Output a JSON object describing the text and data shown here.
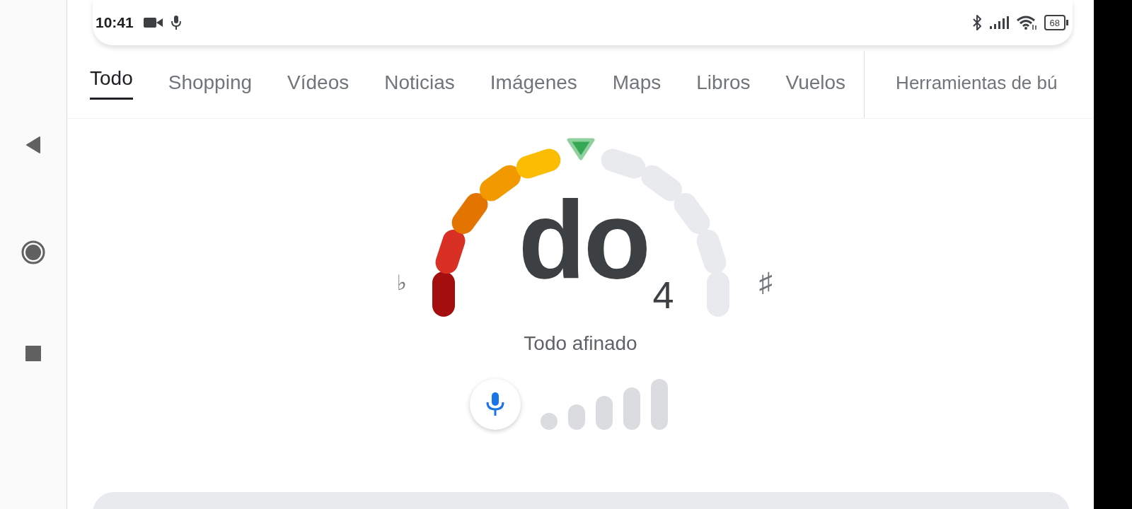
{
  "status_bar": {
    "time": "10:41",
    "battery": "68"
  },
  "nav_buttons": [
    {
      "kind": "back"
    },
    {
      "kind": "home"
    },
    {
      "kind": "recents"
    }
  ],
  "tabs": [
    {
      "label": "Todo",
      "selected": true
    },
    {
      "label": "Shopping",
      "selected": false
    },
    {
      "label": "Vídeos",
      "selected": false
    },
    {
      "label": "Noticias",
      "selected": false
    },
    {
      "label": "Imágenes",
      "selected": false
    },
    {
      "label": "Maps",
      "selected": false
    },
    {
      "label": "Libros",
      "selected": false
    },
    {
      "label": "Vuelos",
      "selected": false
    }
  ],
  "tools_tab": {
    "label": "Herramientas de bú"
  },
  "tuner": {
    "note": "do",
    "octave": "4",
    "flat_sign": "♭",
    "sharp_sign": "♯",
    "status": "Todo afinado",
    "meter": {
      "level": 0.5
    }
  }
}
